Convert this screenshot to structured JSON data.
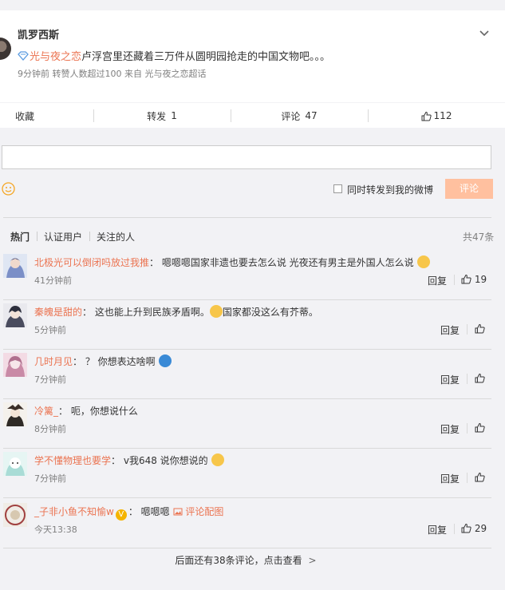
{
  "post": {
    "author": "凯罗西斯",
    "topic": "光与夜之恋",
    "text": "卢浮宫里还藏着三万件从圆明园抢走的中国文物吧。。。",
    "time": "9分钟前",
    "repost_note": "转赞人数超过100",
    "source": "来自 光与夜之恋超话"
  },
  "actions": {
    "collect": "收藏",
    "repost_label": "转发",
    "repost_count": "1",
    "comment_label": "评论",
    "comment_count": "47",
    "like_count": "112"
  },
  "composer": {
    "input_value": "",
    "repost_checkbox_label": "同时转发到我的微博",
    "submit_label": "评论"
  },
  "filters": {
    "tabs": [
      "热门",
      "认证用户",
      "关注的人"
    ],
    "total": "共47条"
  },
  "comments": [
    {
      "user": "北极光可以倒闭吗放过我推",
      "text": "嗯嗯嗯国家非遗也要去怎么说 光夜还有男主是外国人怎么说",
      "emoji": "crying-laugh",
      "time": "41分钟前",
      "reply": "回复",
      "likes": "19"
    },
    {
      "user": "秦魄是甜的",
      "text": "这也能上升到民族矛盾啊。",
      "text2": "国家都没这么有芥蒂。",
      "emoji": "laugh-tears",
      "time": "5分钟前",
      "reply": "回复",
      "likes": ""
    },
    {
      "user": "几时月见",
      "text": "？ 你想表达啥啊",
      "emoji": "doraemon",
      "time": "7分钟前",
      "reply": "回复",
      "likes": ""
    },
    {
      "user": "冷篱_",
      "text": "呃，你想说什么",
      "time": "8分钟前",
      "reply": "回复",
      "likes": ""
    },
    {
      "user": "学不懂物理也要学",
      "text": "v我648 说你想说的",
      "emoji": "smirk",
      "time": "7分钟前",
      "reply": "回复",
      "likes": ""
    },
    {
      "user": "_子非小鱼不知愉w",
      "badge": "V",
      "text": "嗯嗯嗯",
      "link": "评论配图",
      "time": "今天13:38",
      "reply": "回复",
      "likes": "29"
    }
  ],
  "footer": {
    "more_comments": "后面还有38条评论，点击查看",
    "chevron": ">"
  },
  "colors": {
    "accent": "#eb7350",
    "submit_disabled": "#ffc09f",
    "muted": "#808080",
    "background": "#f2f2f5"
  }
}
